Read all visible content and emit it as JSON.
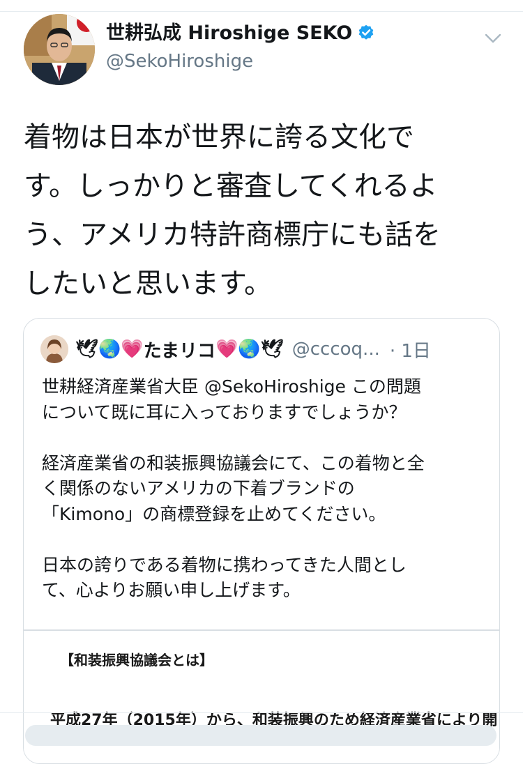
{
  "tweet": {
    "author_name": "世耕弘成 Hiroshige SEKO",
    "author_handle": "@SekoHiroshige",
    "text": "着物は日本が世界に誇る文化で\nす。しっかりと審査してくれるよ\nう、アメリカ特許商標庁にも話を\nしたいと思います。"
  },
  "quoted_tweet": {
    "name_prefix": "🕊🌏💗",
    "name": "たまリコ",
    "name_suffix": "💗🌏🕊",
    "handle": "@cccoq...",
    "time": "· 1日",
    "text": "世耕経済産業省大臣 @SekoHiroshige この問題\nについて既に耳に入っておりますでしょうか？\n\n経済産業省の和装振興協議会にて、この着物と全\nく関係のないアメリカの下着ブランドの\n「Kimono」の商標登録を止めてください。\n\n日本の誇りである着物に携わってきた人間とし\nて、心よりお願い申し上げます。",
    "attached_image": {
      "heading": "【和装振興協議会とは】",
      "line": "平成27年（2015年）から、和装振興のため経済産業省により開"
    }
  },
  "icons": {
    "verified": "verified-badge-icon",
    "caret": "chevron-down-icon"
  },
  "colors": {
    "verified_blue": "#1da1f2",
    "secondary_text": "#657786",
    "border": "#d8dee3"
  }
}
